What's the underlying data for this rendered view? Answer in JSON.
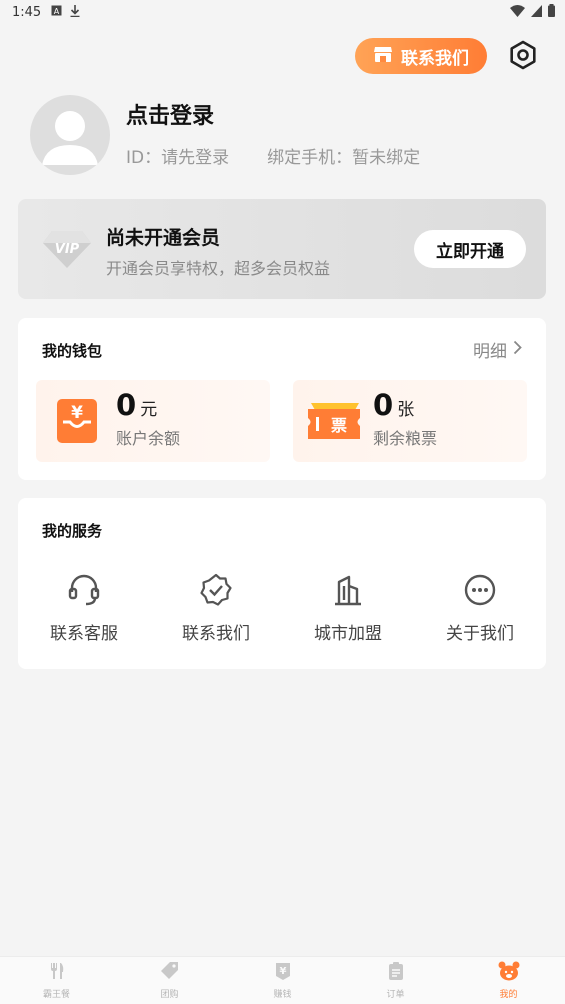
{
  "status_bar": {
    "time": "1:45"
  },
  "header": {
    "contact_label": "联系我们"
  },
  "profile": {
    "title": "点击登录",
    "id_text": "ID：请先登录",
    "phone_text": "绑定手机：暂未绑定"
  },
  "vip": {
    "badge": "VIP",
    "title": "尚未开通会员",
    "desc": "开通会员享特权，超多会员权益",
    "button": "立即开通"
  },
  "wallet": {
    "title": "我的钱包",
    "detail": "明细",
    "balance": {
      "value": "0",
      "unit": "元",
      "label": "账户余额",
      "icon": "¥"
    },
    "tickets": {
      "value": "0",
      "unit": "张",
      "label": "剩余粮票",
      "icon": "票"
    }
  },
  "services": {
    "title": "我的服务",
    "items": [
      {
        "label": "联系客服",
        "icon": "headset-icon"
      },
      {
        "label": "联系我们",
        "icon": "verified-badge-icon"
      },
      {
        "label": "城市加盟",
        "icon": "building-icon"
      },
      {
        "label": "关于我们",
        "icon": "more-dots-icon"
      }
    ]
  },
  "tabbar": {
    "items": [
      {
        "label": "霸王餐",
        "icon": "fork-knife-icon"
      },
      {
        "label": "团购",
        "icon": "tag-icon"
      },
      {
        "label": "赚钱",
        "icon": "money-icon"
      },
      {
        "label": "订单",
        "icon": "clipboard-icon"
      },
      {
        "label": "我的",
        "icon": "bear-icon",
        "active": true
      }
    ]
  },
  "colors": {
    "accent": "#ff7d35",
    "background": "#f4f4f4"
  }
}
